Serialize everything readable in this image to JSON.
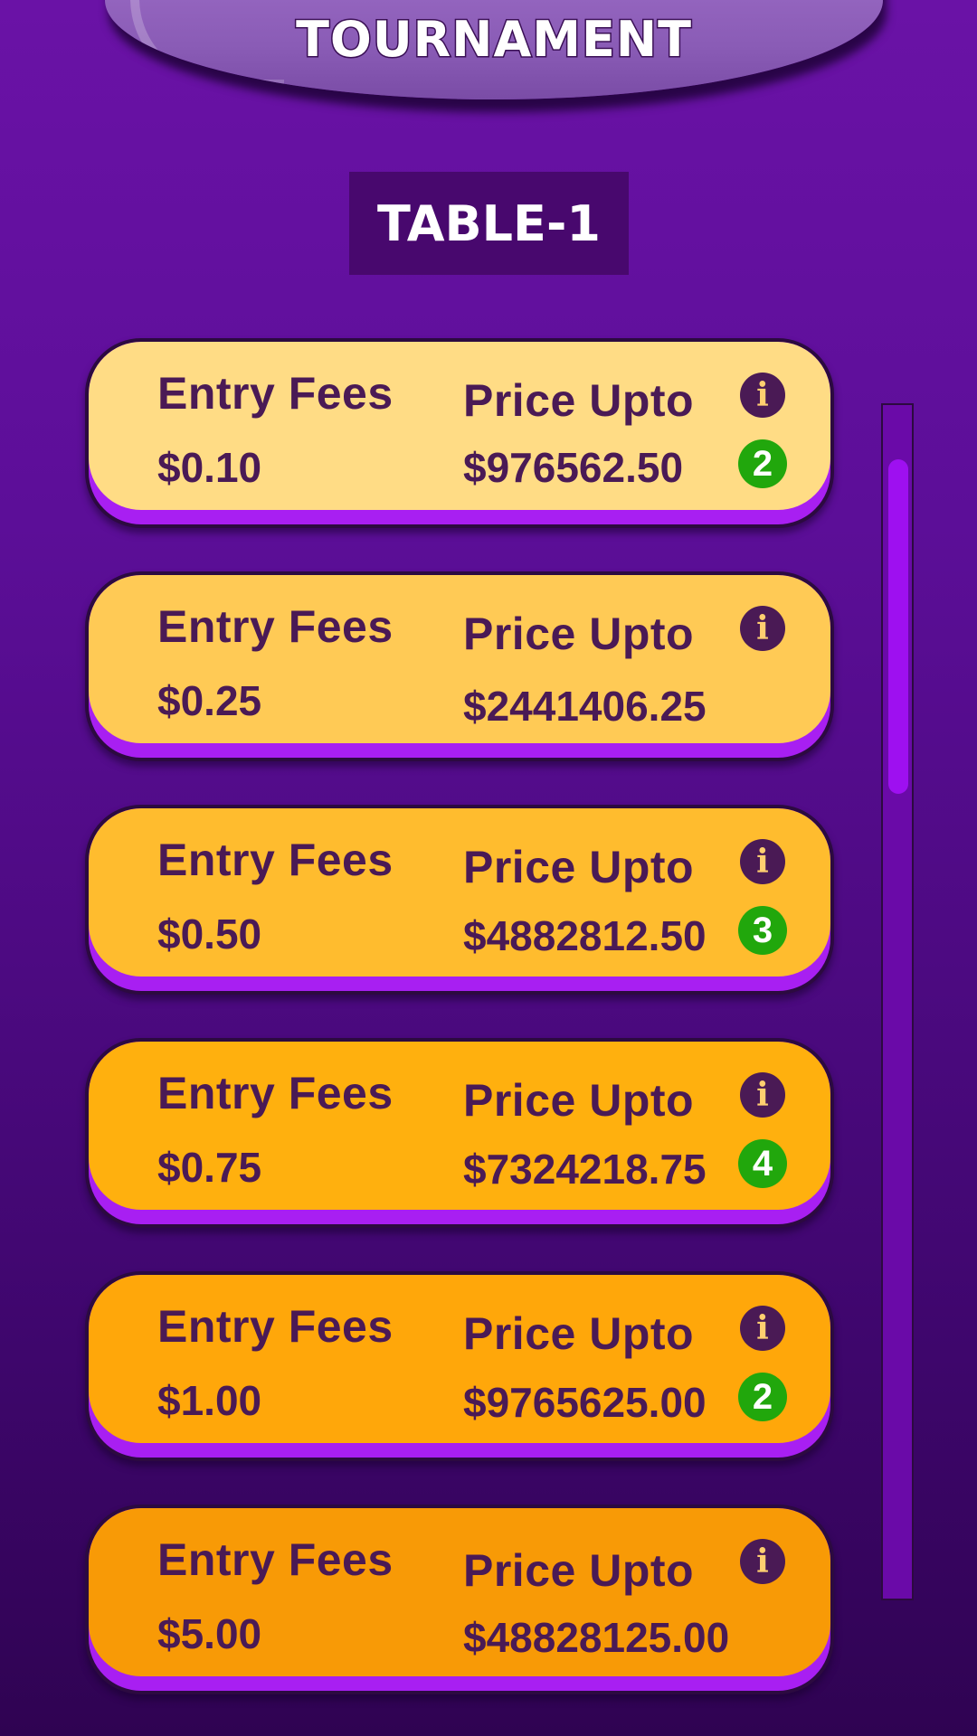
{
  "header": {
    "title": "TOURNAMENT"
  },
  "table": {
    "label": "TABLE-1"
  },
  "cards": [
    {
      "entry_label": "Entry Fees",
      "entry_value": "$0.10",
      "price_label": "Price Upto",
      "price_value": "$976562.50",
      "badge": "2",
      "color": "#ffdc85"
    },
    {
      "entry_label": "Entry Fees",
      "entry_value": "$0.25",
      "price_label": "Price Upto",
      "price_value": "$2441406.25",
      "badge": "",
      "color": "#ffca55"
    },
    {
      "entry_label": "Entry Fees",
      "entry_value": "$0.50",
      "price_label": "Price Upto",
      "price_value": "$4882812.50",
      "badge": "3",
      "color": "#ffbc2e"
    },
    {
      "entry_label": "Entry Fees",
      "entry_value": "$0.75",
      "price_label": "Price Upto",
      "price_value": "$7324218.75",
      "badge": "4",
      "color": "#ffb00e"
    },
    {
      "entry_label": "Entry Fees",
      "entry_value": "$1.00",
      "price_label": "Price Upto",
      "price_value": "$9765625.00",
      "badge": "2",
      "color": "#ffa70a"
    },
    {
      "entry_label": "Entry Fees",
      "entry_value": "$5.00",
      "price_label": "Price Upto",
      "price_value": "$48828125.00",
      "badge": "",
      "color": "#f89a06"
    }
  ],
  "info_icon": {
    "glyph": "i",
    "name": "info-icon"
  },
  "colors": {
    "background": "#5c0e98",
    "text": "#4a1a55",
    "badge": "#21a70c",
    "card_edge": "#a81ff2",
    "scrollbar": "#9e10f0"
  },
  "scroll": {
    "thumb_position": 0.0,
    "visible_fraction": 0.28
  }
}
